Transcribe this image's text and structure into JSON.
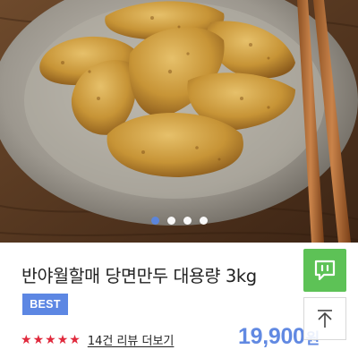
{
  "gallery": {
    "image_alt": "군만두 사진",
    "slide_count": 4,
    "active_slide": 1
  },
  "product": {
    "name": "반야월할매 당면만두 대용량 3kg",
    "badge": "BEST",
    "rating_stars": 5,
    "reviews_link": "14건 리뷰 더보기",
    "price": "19,900",
    "currency": "원"
  },
  "floating": {
    "chat_icon": "chat-bubble-icon",
    "top_icon": "arrow-up-icon"
  },
  "colors": {
    "accent_blue": "#5d87e3",
    "star_red": "#e0293c",
    "chat_green": "#5dc256"
  }
}
